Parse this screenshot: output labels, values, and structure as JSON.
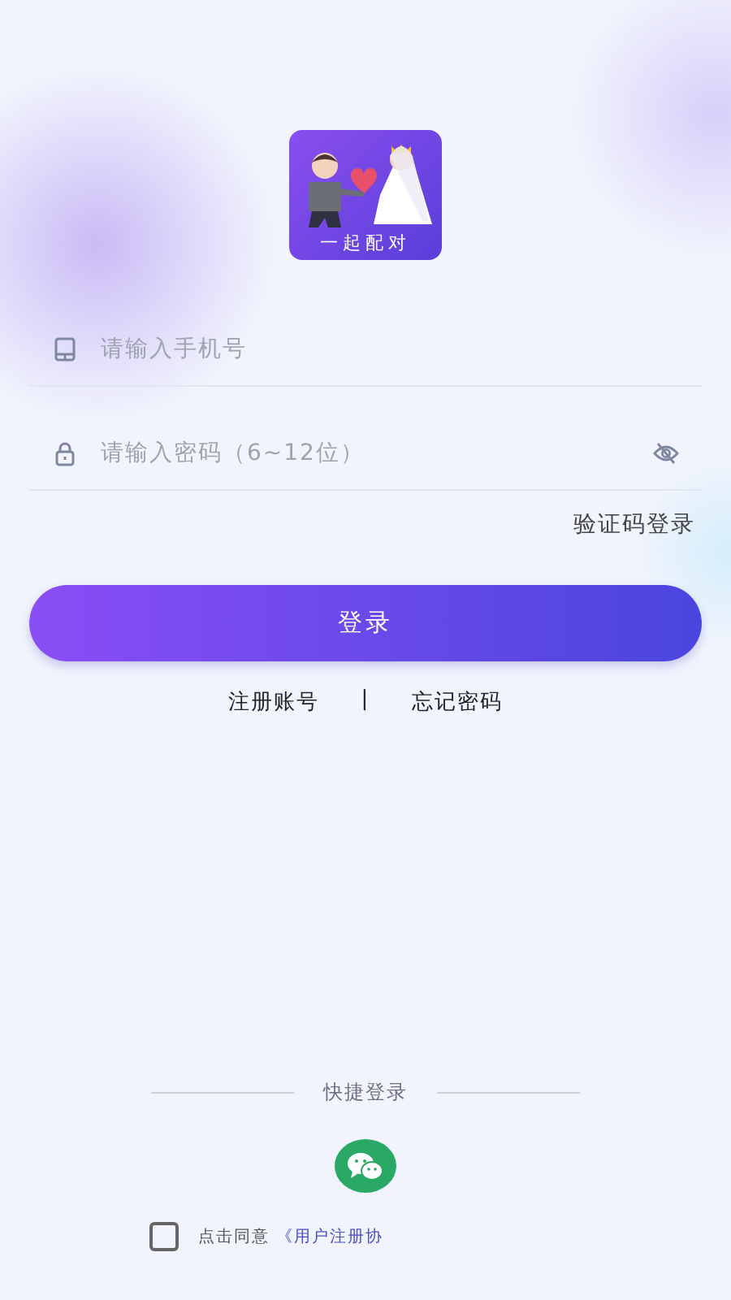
{
  "logo": {
    "caption": "一起配对"
  },
  "phone_field": {
    "placeholder": "请输入手机号"
  },
  "password_field": {
    "placeholder": "请输入密码（6~12位）",
    "password_visible": false
  },
  "code_login_link": "验证码登录",
  "login_button": "登录",
  "links": [
    "注册账号",
    "|",
    "忘记密码"
  ],
  "quick_login": {
    "title": "快捷登录"
  },
  "agreement": {
    "checked": false,
    "text": "点击同意",
    "link": "《用户注册协"
  }
}
